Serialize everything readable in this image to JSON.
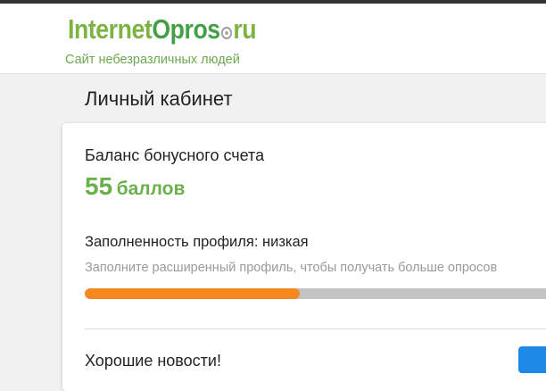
{
  "header": {
    "logo": {
      "part1": "Internet",
      "part2": "Opros",
      "part3": "ru"
    },
    "tagline": "Сайт небезразличных людей"
  },
  "page": {
    "title": "Личный кабинет"
  },
  "bonus": {
    "label": "Баланс бонусного счета",
    "amount": "55",
    "unit": "баллов"
  },
  "profile": {
    "label": "Заполненность профиля: низкая",
    "hint": "Заполните расширенный профиль, чтобы получать больше опросов",
    "progress_fraction": 0.455
  },
  "news": {
    "title": "Хорошие новости!"
  },
  "colors": {
    "accent_green": "#6ab04c",
    "progress_orange": "#f5891f",
    "progress_track": "#c4c4c4",
    "button_blue": "#1e88e5"
  }
}
